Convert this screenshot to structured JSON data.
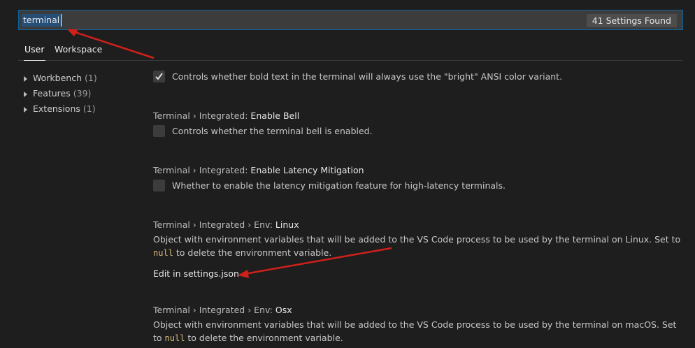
{
  "search": {
    "value": "terminal",
    "count_label": "41 Settings Found"
  },
  "tabs": [
    {
      "label": "User"
    },
    {
      "label": "Workspace"
    }
  ],
  "sidebar": {
    "items": [
      {
        "label": "Workbench",
        "count": "(1)"
      },
      {
        "label": "Features",
        "count": "(39)"
      },
      {
        "label": "Extensions",
        "count": "(1)"
      }
    ]
  },
  "settings": {
    "bright_bold": {
      "description": "Controls whether bold text in the terminal will always use the \"bright\" ANSI color variant.",
      "checked": true
    },
    "enable_bell": {
      "path": "Terminal › Integrated: ",
      "name": "Enable Bell",
      "description": "Controls whether the terminal bell is enabled.",
      "checked": false
    },
    "latency": {
      "path": "Terminal › Integrated: ",
      "name": "Enable Latency Mitigation",
      "description": "Whether to enable the latency mitigation feature for high-latency terminals.",
      "checked": false
    },
    "env_linux": {
      "path": "Terminal › Integrated › Env: ",
      "name": "Linux",
      "description_a": "Object with environment variables that will be added to the VS Code process to be used by the terminal on Linux. Set to ",
      "code": "null",
      "description_b": " to delete the environment variable.",
      "edit_label": "Edit in settings.json"
    },
    "env_osx": {
      "path": "Terminal › Integrated › Env: ",
      "name": "Osx",
      "description_a": "Object with environment variables that will be added to the VS Code process to be used by the terminal on macOS. Set to ",
      "code": "null",
      "description_b": " to delete the environment variable."
    }
  },
  "colors": {
    "background": "#1e1e1e",
    "focus_border": "#0e639c",
    "annotation_arrow": "#d0201a",
    "code": "#d7ba7d"
  }
}
